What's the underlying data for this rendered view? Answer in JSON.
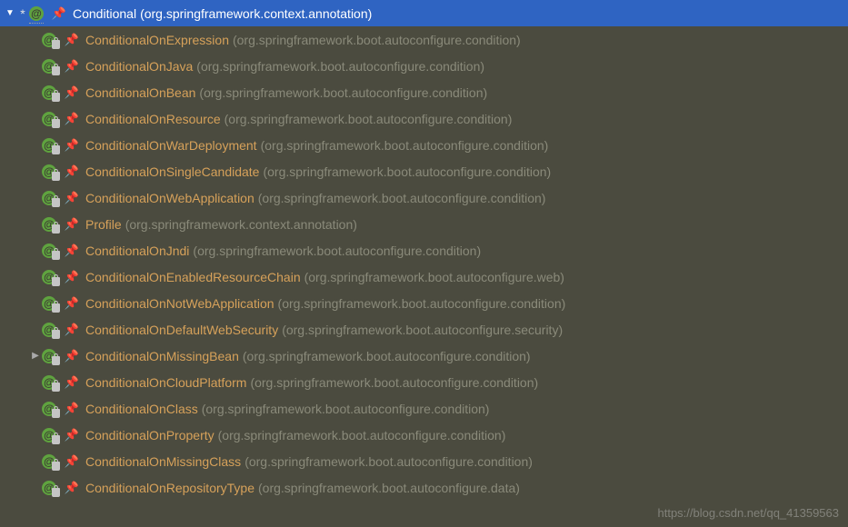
{
  "root": {
    "name": "Conditional",
    "package": "(org.springframework.context.annotation)",
    "expanded": true,
    "starred": true
  },
  "children": [
    {
      "name": "ConditionalOnExpression",
      "package": "(org.springframework.boot.autoconfigure.condition)",
      "arrow": ""
    },
    {
      "name": "ConditionalOnJava",
      "package": "(org.springframework.boot.autoconfigure.condition)",
      "arrow": ""
    },
    {
      "name": "ConditionalOnBean",
      "package": "(org.springframework.boot.autoconfigure.condition)",
      "arrow": ""
    },
    {
      "name": "ConditionalOnResource",
      "package": "(org.springframework.boot.autoconfigure.condition)",
      "arrow": ""
    },
    {
      "name": "ConditionalOnWarDeployment",
      "package": "(org.springframework.boot.autoconfigure.condition)",
      "arrow": ""
    },
    {
      "name": "ConditionalOnSingleCandidate",
      "package": "(org.springframework.boot.autoconfigure.condition)",
      "arrow": ""
    },
    {
      "name": "ConditionalOnWebApplication",
      "package": "(org.springframework.boot.autoconfigure.condition)",
      "arrow": ""
    },
    {
      "name": "Profile",
      "package": "(org.springframework.context.annotation)",
      "arrow": ""
    },
    {
      "name": "ConditionalOnJndi",
      "package": "(org.springframework.boot.autoconfigure.condition)",
      "arrow": ""
    },
    {
      "name": "ConditionalOnEnabledResourceChain",
      "package": "(org.springframework.boot.autoconfigure.web)",
      "arrow": ""
    },
    {
      "name": "ConditionalOnNotWebApplication",
      "package": "(org.springframework.boot.autoconfigure.condition)",
      "arrow": ""
    },
    {
      "name": "ConditionalOnDefaultWebSecurity",
      "package": "(org.springframework.boot.autoconfigure.security)",
      "arrow": ""
    },
    {
      "name": "ConditionalOnMissingBean",
      "package": "(org.springframework.boot.autoconfigure.condition)",
      "arrow": "▶"
    },
    {
      "name": "ConditionalOnCloudPlatform",
      "package": "(org.springframework.boot.autoconfigure.condition)",
      "arrow": ""
    },
    {
      "name": "ConditionalOnClass",
      "package": "(org.springframework.boot.autoconfigure.condition)",
      "arrow": ""
    },
    {
      "name": "ConditionalOnProperty",
      "package": "(org.springframework.boot.autoconfigure.condition)",
      "arrow": ""
    },
    {
      "name": "ConditionalOnMissingClass",
      "package": "(org.springframework.boot.autoconfigure.condition)",
      "arrow": ""
    },
    {
      "name": "ConditionalOnRepositoryType",
      "package": "(org.springframework.boot.autoconfigure.data)",
      "arrow": ""
    }
  ],
  "watermark": "https://blog.csdn.net/qq_41359563"
}
